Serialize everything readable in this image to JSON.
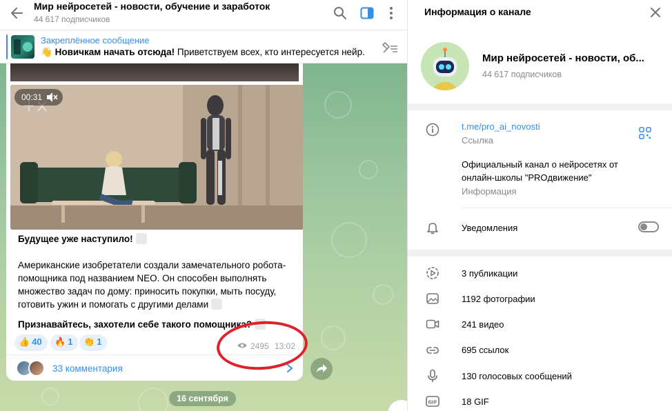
{
  "header": {
    "title": "Мир нейросетей - новости, обучение и заработок",
    "subtitle": "44 617 подписчиков",
    "icons": [
      "back-arrow-icon",
      "search-icon",
      "sidebar-panel-icon",
      "more-vertical-icon"
    ]
  },
  "pinned": {
    "title": "Закреплённое сообщение",
    "emoji": "👋",
    "bold_text": "Новичкам начать отсюда!",
    "text": "Приветствуем всех, кто интересуется нейр..."
  },
  "message": {
    "video_time": "00:31",
    "heading": "Будущее уже наступило!",
    "body": "Американские изобретатели создали замечательного робота-помощника под названием NEO. Он способен выполнять множество задач по дому: приносить покупки, мыть посуду, готовить ужин и помогать с другими делами",
    "closing": "Признавайтесь, захотели себе такого помощника?",
    "reactions": [
      {
        "emoji": "👍",
        "count": "40"
      },
      {
        "emoji": "🔥",
        "count": "1"
      },
      {
        "emoji": "👏",
        "count": "1"
      }
    ],
    "views": "2495",
    "time": "13:02",
    "comments_label": "33 комментария"
  },
  "date_pill": "16 сентября",
  "info_panel": {
    "title": "Информация о канале",
    "channel_name": "Мир нейросетей - новости, об...",
    "subscribers": "44 617 подписчиков",
    "link": "t.me/pro_ai_novosti",
    "link_caption": "Ссылка",
    "description": "Официальный канал о нейросетях от онлайн-школы \"PROдвижение\"",
    "description_caption": "Информация",
    "notifications_label": "Уведомления",
    "stats": [
      {
        "icon": "publications-icon",
        "label": "3 публикации"
      },
      {
        "icon": "photo-icon",
        "label": "1192 фотографии"
      },
      {
        "icon": "video-icon",
        "label": "241 видео"
      },
      {
        "icon": "link-icon",
        "label": "695 ссылок"
      },
      {
        "icon": "microphone-icon",
        "label": "130 голосовых сообщений"
      },
      {
        "icon": "gif-icon",
        "label": "18 GIF"
      }
    ]
  },
  "colors": {
    "accent": "#3390ec",
    "highlight_circle": "#e0212b",
    "chat_background": "#9dc6a0"
  }
}
